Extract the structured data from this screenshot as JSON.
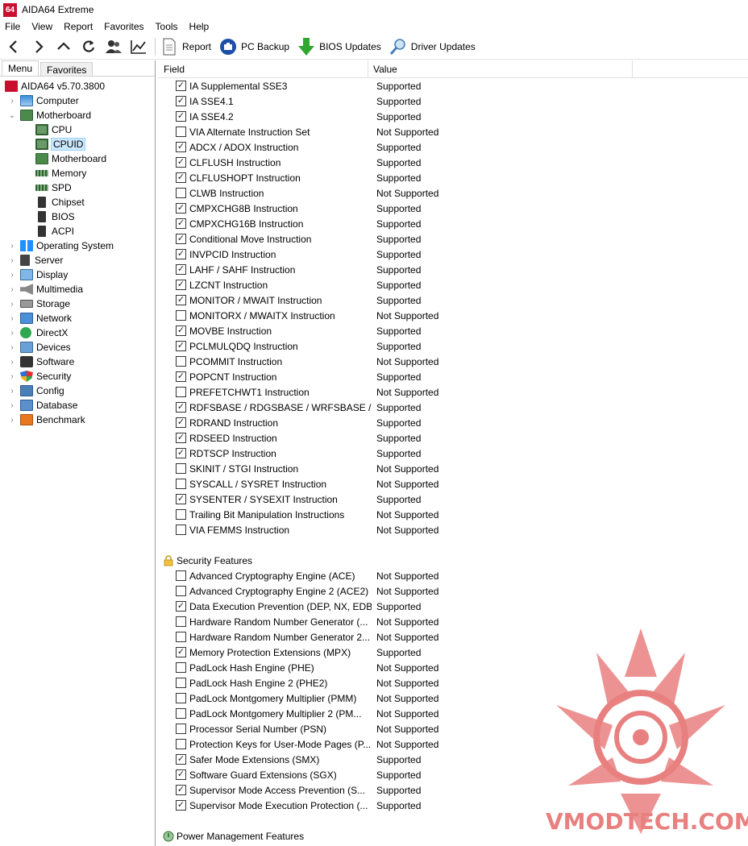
{
  "window": {
    "logo": "64",
    "title": "AIDA64 Extreme"
  },
  "menubar": [
    "File",
    "View",
    "Report",
    "Favorites",
    "Tools",
    "Help"
  ],
  "toolbar": {
    "nav_icons": [
      "back-icon",
      "forward-icon",
      "up-icon",
      "refresh-icon",
      "users-icon",
      "chart-icon"
    ],
    "buttons": [
      {
        "label": "Report",
        "icon": "report-icon"
      },
      {
        "label": "PC Backup",
        "icon": "backup-icon"
      },
      {
        "label": "BIOS Updates",
        "icon": "download-arrow-icon"
      },
      {
        "label": "Driver Updates",
        "icon": "magnifier-icon"
      }
    ]
  },
  "tabs": {
    "menu": "Menu",
    "favorites": "Favorites"
  },
  "tree": {
    "root": "AIDA64 v5.70.3800",
    "items": [
      {
        "label": "Computer",
        "icon": "computer-icon",
        "expanded": false
      },
      {
        "label": "Motherboard",
        "icon": "motherboard-icon",
        "expanded": true,
        "children": [
          "CPU",
          "CPUID",
          "Motherboard",
          "Memory",
          "SPD",
          "Chipset",
          "BIOS",
          "ACPI"
        ]
      },
      {
        "label": "Operating System",
        "icon": "windows-icon"
      },
      {
        "label": "Server",
        "icon": "server-icon"
      },
      {
        "label": "Display",
        "icon": "display-icon"
      },
      {
        "label": "Multimedia",
        "icon": "multimedia-icon"
      },
      {
        "label": "Storage",
        "icon": "storage-icon"
      },
      {
        "label": "Network",
        "icon": "network-icon"
      },
      {
        "label": "DirectX",
        "icon": "directx-icon"
      },
      {
        "label": "Devices",
        "icon": "devices-icon"
      },
      {
        "label": "Software",
        "icon": "software-icon"
      },
      {
        "label": "Security",
        "icon": "security-icon"
      },
      {
        "label": "Config",
        "icon": "config-icon"
      },
      {
        "label": "Database",
        "icon": "database-icon"
      },
      {
        "label": "Benchmark",
        "icon": "benchmark-icon"
      }
    ],
    "selected": "CPUID"
  },
  "columns": {
    "field": "Field",
    "value": "Value"
  },
  "instruction_rows": [
    {
      "field": "IA Supplemental SSE3",
      "value": "Supported",
      "checked": true
    },
    {
      "field": "IA SSE4.1",
      "value": "Supported",
      "checked": true
    },
    {
      "field": "IA SSE4.2",
      "value": "Supported",
      "checked": true
    },
    {
      "field": "VIA Alternate Instruction Set",
      "value": "Not Supported",
      "checked": false
    },
    {
      "field": "ADCX / ADOX Instruction",
      "value": "Supported",
      "checked": true
    },
    {
      "field": "CLFLUSH Instruction",
      "value": "Supported",
      "checked": true
    },
    {
      "field": "CLFLUSHOPT Instruction",
      "value": "Supported",
      "checked": true
    },
    {
      "field": "CLWB Instruction",
      "value": "Not Supported",
      "checked": false
    },
    {
      "field": "CMPXCHG8B Instruction",
      "value": "Supported",
      "checked": true
    },
    {
      "field": "CMPXCHG16B Instruction",
      "value": "Supported",
      "checked": true
    },
    {
      "field": "Conditional Move Instruction",
      "value": "Supported",
      "checked": true
    },
    {
      "field": "INVPCID Instruction",
      "value": "Supported",
      "checked": true
    },
    {
      "field": "LAHF / SAHF Instruction",
      "value": "Supported",
      "checked": true
    },
    {
      "field": "LZCNT Instruction",
      "value": "Supported",
      "checked": true
    },
    {
      "field": "MONITOR / MWAIT Instruction",
      "value": "Supported",
      "checked": true
    },
    {
      "field": "MONITORX / MWAITX Instruction",
      "value": "Not Supported",
      "checked": false
    },
    {
      "field": "MOVBE Instruction",
      "value": "Supported",
      "checked": true
    },
    {
      "field": "PCLMULQDQ Instruction",
      "value": "Supported",
      "checked": true
    },
    {
      "field": "PCOMMIT Instruction",
      "value": "Not Supported",
      "checked": false
    },
    {
      "field": "POPCNT Instruction",
      "value": "Supported",
      "checked": true
    },
    {
      "field": "PREFETCHWT1 Instruction",
      "value": "Not Supported",
      "checked": false
    },
    {
      "field": "RDFSBASE / RDGSBASE / WRFSBASE / W...",
      "value": "Supported",
      "checked": true
    },
    {
      "field": "RDRAND Instruction",
      "value": "Supported",
      "checked": true
    },
    {
      "field": "RDSEED Instruction",
      "value": "Supported",
      "checked": true
    },
    {
      "field": "RDTSCP Instruction",
      "value": "Supported",
      "checked": true
    },
    {
      "field": "SKINIT / STGI Instruction",
      "value": "Not Supported",
      "checked": false
    },
    {
      "field": "SYSCALL / SYSRET Instruction",
      "value": "Not Supported",
      "checked": false
    },
    {
      "field": "SYSENTER / SYSEXIT Instruction",
      "value": "Supported",
      "checked": true
    },
    {
      "field": "Trailing Bit Manipulation Instructions",
      "value": "Not Supported",
      "checked": false
    },
    {
      "field": "VIA FEMMS Instruction",
      "value": "Not Supported",
      "checked": false
    }
  ],
  "security_section": {
    "title": "Security Features",
    "icon": "lock-icon",
    "rows": [
      {
        "field": "Advanced Cryptography Engine (ACE)",
        "value": "Not Supported",
        "checked": false
      },
      {
        "field": "Advanced Cryptography Engine 2 (ACE2)",
        "value": "Not Supported",
        "checked": false
      },
      {
        "field": "Data Execution Prevention (DEP, NX, EDB)",
        "value": "Supported",
        "checked": true
      },
      {
        "field": "Hardware Random Number Generator (...",
        "value": "Not Supported",
        "checked": false
      },
      {
        "field": "Hardware Random Number Generator 2...",
        "value": "Not Supported",
        "checked": false
      },
      {
        "field": "Memory Protection Extensions (MPX)",
        "value": "Supported",
        "checked": true
      },
      {
        "field": "PadLock Hash Engine (PHE)",
        "value": "Not Supported",
        "checked": false
      },
      {
        "field": "PadLock Hash Engine 2 (PHE2)",
        "value": "Not Supported",
        "checked": false
      },
      {
        "field": "PadLock Montgomery Multiplier (PMM)",
        "value": "Not Supported",
        "checked": false
      },
      {
        "field": "PadLock Montgomery Multiplier 2 (PM...",
        "value": "Not Supported",
        "checked": false
      },
      {
        "field": "Processor Serial Number (PSN)",
        "value": "Not Supported",
        "checked": false
      },
      {
        "field": "Protection Keys for User-Mode Pages (P...",
        "value": "Not Supported",
        "checked": false
      },
      {
        "field": "Safer Mode Extensions (SMX)",
        "value": "Supported",
        "checked": true
      },
      {
        "field": "Software Guard Extensions (SGX)",
        "value": "Supported",
        "checked": true
      },
      {
        "field": "Supervisor Mode Access Prevention (S...",
        "value": "Supported",
        "checked": true
      },
      {
        "field": "Supervisor Mode Execution Protection (...",
        "value": "Supported",
        "checked": true
      }
    ]
  },
  "power_section": {
    "title": "Power Management Features",
    "icon": "power-management-icon"
  },
  "watermark": {
    "text": "VMODTECH.COM",
    "color": "#e98080"
  },
  "colors": {
    "brand": "#c8102e",
    "selection": "#cce8ff",
    "green_arrow": "#2ea82e",
    "backup_blue": "#1c4fa8"
  }
}
